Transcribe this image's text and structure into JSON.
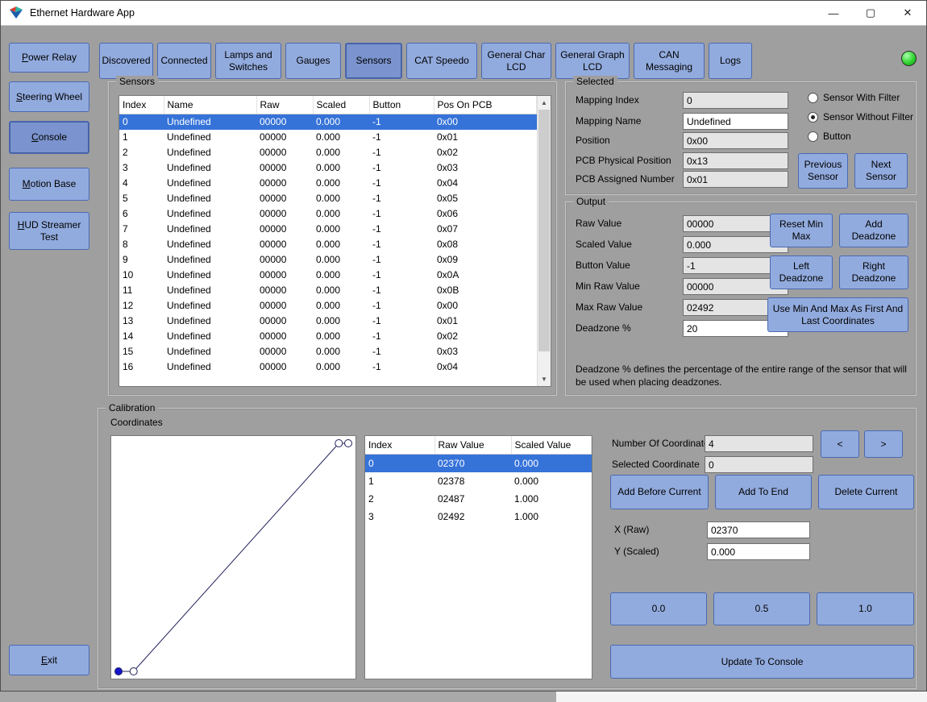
{
  "window": {
    "title": "Ethernet Hardware App",
    "minimize": "—",
    "maximize": "▢",
    "close": "✕"
  },
  "colors": {
    "button_fill": "#92abde",
    "button_border": "#4a69b2",
    "active_button_fill": "#7b93ce",
    "selection_blue": "#3673d9",
    "window_gray": "#9f9f9f",
    "led_green": "#2fd32f"
  },
  "icons": {
    "scroll_up": "▲",
    "scroll_down": "▼"
  },
  "sidebar": {
    "items": [
      {
        "label": "Power Relay",
        "active": false
      },
      {
        "label": "Steering Wheel",
        "active": false
      },
      {
        "label": "Console",
        "active": true
      },
      {
        "label": "Motion Base",
        "active": false
      },
      {
        "label": "HUD Streamer Test",
        "active": false
      }
    ],
    "exit": {
      "label": "Exit"
    }
  },
  "tabs": [
    {
      "label": "Discovered",
      "active": false
    },
    {
      "label": "Connected",
      "active": false
    },
    {
      "label": "Lamps and Switches",
      "active": false
    },
    {
      "label": "Gauges",
      "active": false
    },
    {
      "label": "Sensors",
      "active": true
    },
    {
      "label": "CAT Speedo",
      "active": false
    },
    {
      "label": "General Char LCD",
      "active": false
    },
    {
      "label": "General Graph LCD",
      "active": false
    },
    {
      "label": "CAN Messaging",
      "active": false
    },
    {
      "label": "Logs",
      "active": false
    }
  ],
  "sensors_panel": {
    "group_label": "Sensors",
    "table": {
      "columns": [
        "Index",
        "Name",
        "Raw",
        "Scaled",
        "Button",
        "Pos On PCB"
      ],
      "selected_row": 0,
      "rows": [
        [
          "0",
          "Undefined",
          "00000",
          "0.000",
          "-1",
          "0x00"
        ],
        [
          "1",
          "Undefined",
          "00000",
          "0.000",
          "-1",
          "0x01"
        ],
        [
          "2",
          "Undefined",
          "00000",
          "0.000",
          "-1",
          "0x02"
        ],
        [
          "3",
          "Undefined",
          "00000",
          "0.000",
          "-1",
          "0x03"
        ],
        [
          "4",
          "Undefined",
          "00000",
          "0.000",
          "-1",
          "0x04"
        ],
        [
          "5",
          "Undefined",
          "00000",
          "0.000",
          "-1",
          "0x05"
        ],
        [
          "6",
          "Undefined",
          "00000",
          "0.000",
          "-1",
          "0x06"
        ],
        [
          "7",
          "Undefined",
          "00000",
          "0.000",
          "-1",
          "0x07"
        ],
        [
          "8",
          "Undefined",
          "00000",
          "0.000",
          "-1",
          "0x08"
        ],
        [
          "9",
          "Undefined",
          "00000",
          "0.000",
          "-1",
          "0x09"
        ],
        [
          "10",
          "Undefined",
          "00000",
          "0.000",
          "-1",
          "0x0A"
        ],
        [
          "11",
          "Undefined",
          "00000",
          "0.000",
          "-1",
          "0x0B"
        ],
        [
          "12",
          "Undefined",
          "00000",
          "0.000",
          "-1",
          "0x00"
        ],
        [
          "13",
          "Undefined",
          "00000",
          "0.000",
          "-1",
          "0x01"
        ],
        [
          "14",
          "Undefined",
          "00000",
          "0.000",
          "-1",
          "0x02"
        ],
        [
          "15",
          "Undefined",
          "00000",
          "0.000",
          "-1",
          "0x03"
        ],
        [
          "16",
          "Undefined",
          "00000",
          "0.000",
          "-1",
          "0x04"
        ]
      ]
    }
  },
  "selected_panel": {
    "group_label": "Selected",
    "mapping_index": {
      "label": "Mapping Index",
      "value": "0"
    },
    "mapping_name": {
      "label": "Mapping Name",
      "value": "Undefined"
    },
    "position": {
      "label": "Position",
      "value": "0x00"
    },
    "pcb_physical": {
      "label": "PCB Physical Position",
      "value": "0x13"
    },
    "pcb_assigned": {
      "label": "PCB Assigned Number",
      "value": "0x01"
    },
    "radio_with_filter": {
      "label": "Sensor With Filter",
      "checked": false
    },
    "radio_without_filter": {
      "label": "Sensor Without Filter",
      "checked": true
    },
    "radio_button": {
      "label": "Button",
      "checked": false
    },
    "previous_button": "Previous Sensor",
    "next_button": "Next Sensor"
  },
  "output_panel": {
    "group_label": "Output",
    "raw_value": {
      "label": "Raw Value",
      "value": "00000"
    },
    "scaled_value": {
      "label": "Scaled Value",
      "value": "0.000"
    },
    "button_value": {
      "label": "Button Value",
      "value": "-1"
    },
    "min_raw": {
      "label": "Min Raw Value",
      "value": "00000"
    },
    "max_raw": {
      "label": "Max Raw Value",
      "value": "02492"
    },
    "deadzone": {
      "label": "Deadzone %",
      "value": "20"
    },
    "reset_min_max_button": "Reset Min Max",
    "add_deadzone_button": "Add Deadzone",
    "left_deadzone_button": "Left Deadzone",
    "right_deadzone_button": "Right Deadzone",
    "use_min_max_button": "Use Min And Max As First And Last Coordinates",
    "note": "Deadzone % defines the percentage of the entire range of the sensor that will be used when placing deadzones."
  },
  "calibration": {
    "group_label": "Calibration",
    "coordinates_label": "Coordinates",
    "table": {
      "columns": [
        "Index",
        "Raw Value",
        "Scaled Value"
      ],
      "selected_row": 0,
      "rows": [
        [
          "0",
          "02370",
          "0.000"
        ],
        [
          "1",
          "02378",
          "0.000"
        ],
        [
          "2",
          "02487",
          "1.000"
        ],
        [
          "3",
          "02492",
          "1.000"
        ]
      ]
    },
    "points": [
      {
        "raw": 2370,
        "scaled": 0
      },
      {
        "raw": 2378,
        "scaled": 0
      },
      {
        "raw": 2487,
        "scaled": 1
      },
      {
        "raw": 2492,
        "scaled": 1
      }
    ],
    "selected_point": 0,
    "num_coordinates": {
      "label": "Number Of Coordinates",
      "value": "4"
    },
    "selected_coordinate": {
      "label": "Selected Coordinate",
      "value": "0"
    },
    "prev_button": "<",
    "next_button": ">",
    "add_before_button": "Add Before Current",
    "add_to_end_button": "Add To End",
    "delete_current_button": "Delete Current",
    "x_field": {
      "label": "X (Raw)",
      "value": "02370"
    },
    "y_field": {
      "label": "Y (Scaled)",
      "value": "0.000"
    },
    "zero_button": "0.0",
    "half_button": "0.5",
    "one_button": "1.0",
    "update_button": "Update To Console"
  }
}
